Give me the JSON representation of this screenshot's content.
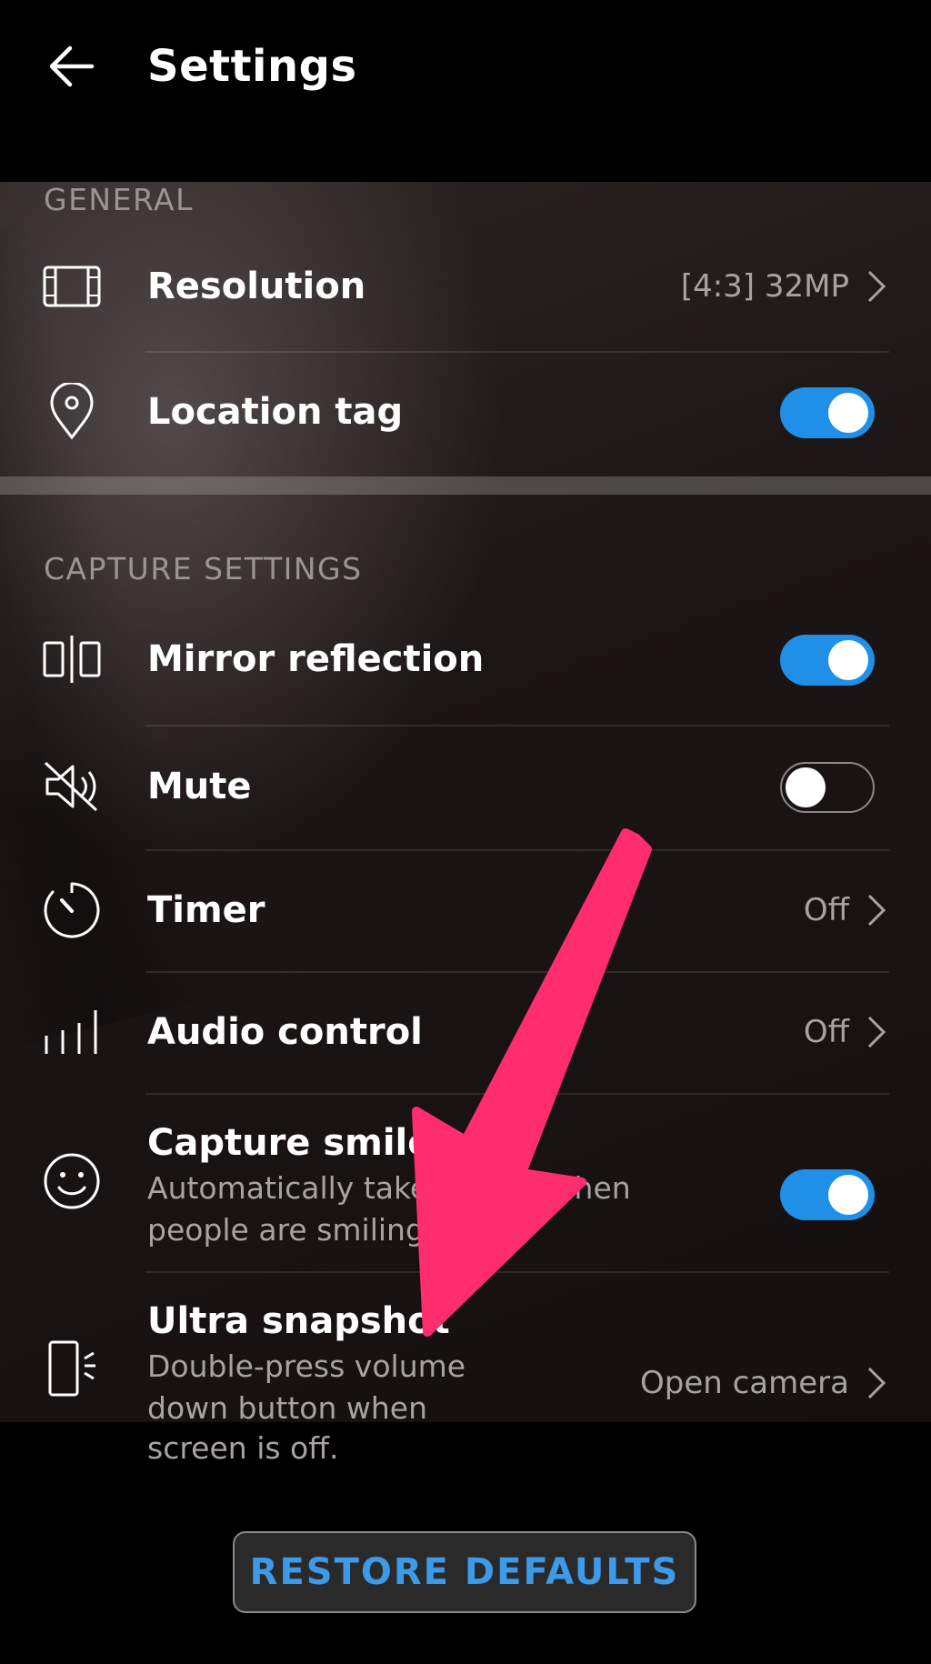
{
  "header": {
    "title": "Settings",
    "back_icon": "back-arrow-icon"
  },
  "sections": {
    "general": "GENERAL",
    "capture": "CAPTURE SETTINGS"
  },
  "rows": {
    "resolution": {
      "title": "Resolution",
      "value": "[4:3] 32MP",
      "icon": "resolution-icon"
    },
    "location": {
      "title": "Location tag",
      "toggle": "on",
      "icon": "location-pin-icon"
    },
    "mirror": {
      "title": "Mirror reflection",
      "toggle": "on",
      "icon": "mirror-icon"
    },
    "mute": {
      "title": "Mute",
      "toggle": "off",
      "icon": "mute-icon"
    },
    "timer": {
      "title": "Timer",
      "value": "Off",
      "icon": "timer-icon"
    },
    "audio": {
      "title": "Audio control",
      "value": "Off",
      "icon": "audio-control-icon"
    },
    "smiles": {
      "title": "Capture smiles",
      "sub1": "Automatically take photos when",
      "sub2": "people are smiling",
      "toggle": "on",
      "icon": "smile-icon"
    },
    "ultra": {
      "title": "Ultra snapshot",
      "sub1": "Double-press volume",
      "sub2": "down button when",
      "sub3": "screen is off.",
      "value": "Open camera",
      "icon": "phone-volume-icon"
    }
  },
  "restore_label": "RESTORE DEFAULTS",
  "colors": {
    "accent": "#1f8fe8",
    "arrow": "#ff2d6e",
    "button_text": "#3d9ae8"
  }
}
